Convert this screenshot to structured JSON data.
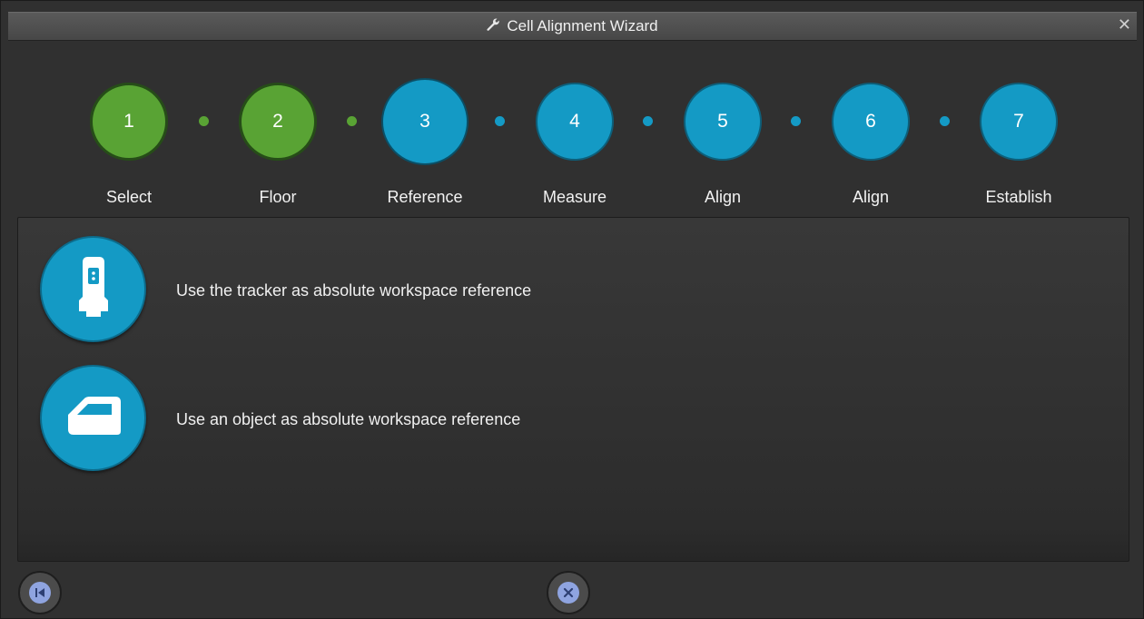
{
  "window": {
    "title": "Cell Alignment Wizard",
    "title_icon": "wrench-icon",
    "close_icon": "close-icon",
    "close_glyph": "✕"
  },
  "steps": [
    {
      "number": "1",
      "label": "Select",
      "state": "done"
    },
    {
      "number": "2",
      "label": "Floor",
      "state": "done"
    },
    {
      "number": "3",
      "label": "Reference",
      "state": "active"
    },
    {
      "number": "4",
      "label": "Measure",
      "state": "todo"
    },
    {
      "number": "5",
      "label": "Align",
      "state": "todo"
    },
    {
      "number": "6",
      "label": "Align",
      "state": "todo"
    },
    {
      "number": "7",
      "label": "Establish",
      "state": "todo"
    }
  ],
  "options": [
    {
      "text": "Use the tracker as absolute workspace reference",
      "icon": "tracker-icon"
    },
    {
      "text": "Use an object as absolute workspace reference",
      "icon": "object-icon"
    }
  ],
  "footer": {
    "back_icon": "skip-back-icon",
    "cancel_icon": "cancel-icon"
  },
  "colors": {
    "done": "#59a334",
    "active": "#149ac5",
    "todo": "#149ac5",
    "background": "#303030"
  }
}
